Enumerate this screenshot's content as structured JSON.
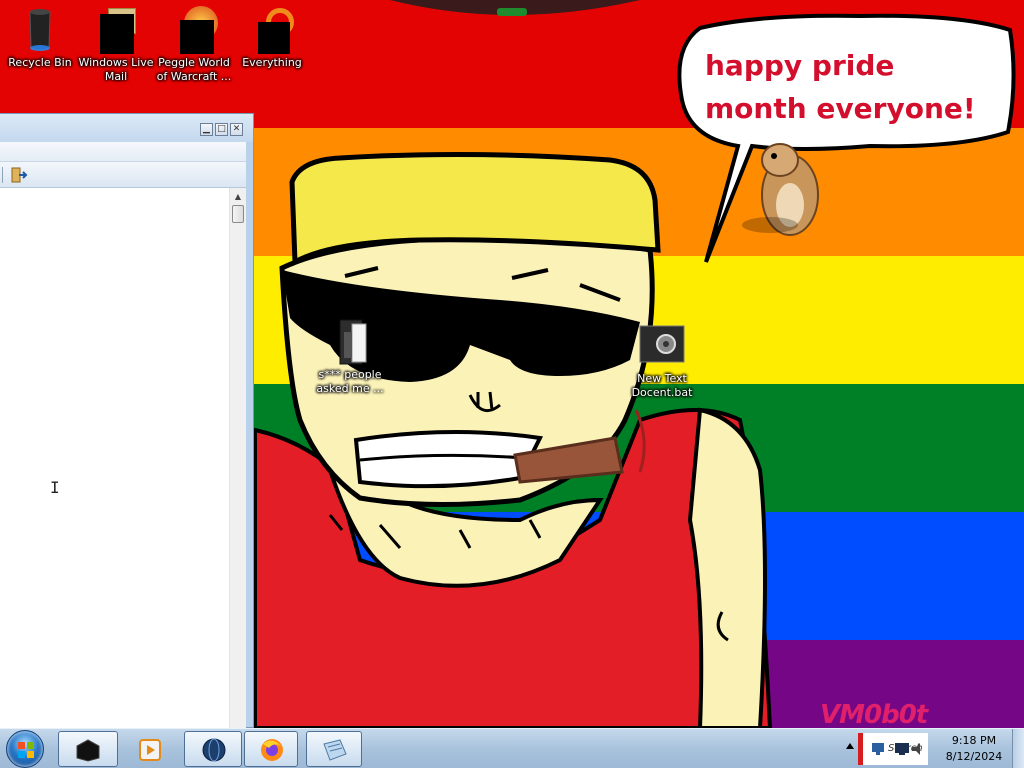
{
  "desktop": {
    "speech_bubble_text": "happy pride month everyone!",
    "watermark": "VM0b0t",
    "icons": [
      {
        "label": "Recycle Bin",
        "icon": "recycle-bin-icon"
      },
      {
        "label": "Windows Live Mail",
        "icon": "windows-live-mail-icon"
      },
      {
        "label": "Peggle World of Warcraft ...",
        "icon": "peggle-icon"
      },
      {
        "label": "Everything",
        "icon": "everything-search-icon"
      },
      {
        "label": "s*** people asked me ...",
        "icon": "folder-icon"
      },
      {
        "label": "New Text Docent.bat",
        "icon": "batch-file-icon"
      }
    ]
  },
  "window": {
    "title_buttons": [
      "minimize",
      "maximize",
      "close"
    ],
    "toolbar_icon": "exit-icon"
  },
  "taskbar": {
    "start_icon": "windows-start-orb",
    "buttons": [
      {
        "icon": "black-app-icon",
        "active": true
      },
      {
        "icon": "media-player-icon",
        "active": false
      },
      {
        "icon": "globe-app-icon",
        "active": true
      },
      {
        "icon": "firefox-icon",
        "active": true
      },
      {
        "icon": "notepad-icon",
        "active": true
      }
    ],
    "tray": {
      "search_text": "Search",
      "time": "9:18 PM",
      "date": "8/12/2024"
    }
  },
  "colors": {
    "rainbow": [
      "#e40303",
      "#ff8c00",
      "#ffed00",
      "#008026",
      "#004dff",
      "#750787"
    ],
    "bubble_text": "#d40f2e",
    "skin": "#fbf2b8",
    "hair": "#f5e84a",
    "tank_top": "#e41e26",
    "cigar": "#98553a"
  }
}
